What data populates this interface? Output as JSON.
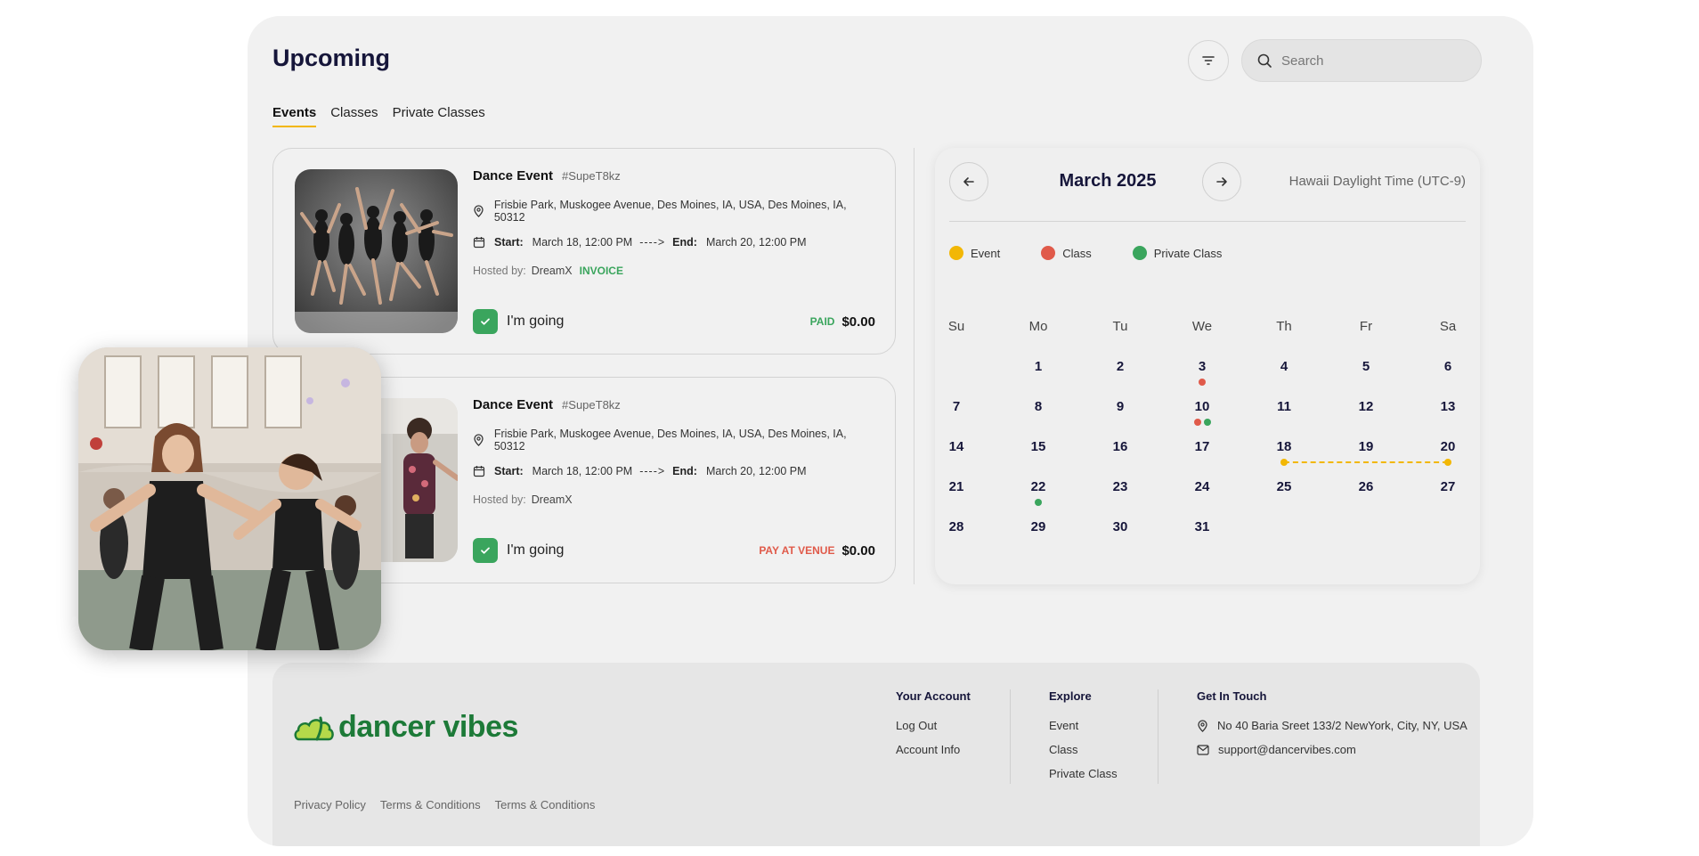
{
  "header": {
    "title": "Upcoming",
    "search_placeholder": "Search"
  },
  "tabs": [
    {
      "label": "Events",
      "active": true
    },
    {
      "label": "Classes",
      "active": false
    },
    {
      "label": "Private Classes",
      "active": false
    }
  ],
  "events": [
    {
      "title": "Dance Event",
      "code": "#SupeT8kz",
      "location": "Frisbie Park, Muskogee Avenue, Des Moines, IA, USA, Des Moines, IA, 50312",
      "start_label": "Start:",
      "start": "March 18, 12:00 PM",
      "arrow": "---->",
      "end_label": "End:",
      "end": "March 20, 12:00 PM",
      "hosted_label": "Hosted by:",
      "host": "DreamX",
      "invoice": "INVOICE",
      "going": "I'm going",
      "status": "PAID",
      "price": "$0.00"
    },
    {
      "title": "Dance Event",
      "code": "#SupeT8kz",
      "location": "Frisbie Park, Muskogee Avenue, Des Moines, IA, USA, Des Moines, IA, 50312",
      "start_label": "Start:",
      "start": "March 18, 12:00 PM",
      "arrow": "---->",
      "end_label": "End:",
      "end": "March 20, 12:00 PM",
      "hosted_label": "Hosted by:",
      "host": "DreamX",
      "going": "I'm going",
      "status": "PAY AT VENUE",
      "price": "$0.00"
    }
  ],
  "calendar": {
    "month": "March 2025",
    "timezone": "Hawaii Daylight Time (UTC-9)",
    "legend": [
      {
        "label": "Event",
        "color": "#f2b705"
      },
      {
        "label": "Class",
        "color": "#e05a4a"
      },
      {
        "label": "Private Class",
        "color": "#3aa55d"
      }
    ],
    "weekdays": [
      "Su",
      "Mo",
      "Tu",
      "We",
      "Th",
      "Fr",
      "Sa"
    ],
    "days_in_month": 31,
    "first_weekday": 1,
    "markers": [
      {
        "day": 3,
        "types": [
          "class"
        ]
      },
      {
        "day": 10,
        "types": [
          "class",
          "private"
        ]
      },
      {
        "day": 18,
        "types": [
          "event"
        ]
      },
      {
        "day": 20,
        "types": [
          "event"
        ]
      },
      {
        "day": 22,
        "types": [
          "private"
        ]
      }
    ],
    "event_range": [
      18,
      20
    ]
  },
  "footer": {
    "logo_text": "ancer vibes",
    "logo_initial": "d",
    "your_account": {
      "heading": "Your Account",
      "links": [
        "Log Out",
        "Account Info"
      ]
    },
    "explore": {
      "heading": "Explore",
      "links": [
        "Event",
        "Class",
        "Private Class"
      ]
    },
    "contact": {
      "heading": "Get In Touch",
      "address": "No 40 Baria Sreet 133/2 NewYork, City, NY, USA",
      "email": "support@dancervibes.com"
    },
    "legal": [
      "Privacy Policy",
      "Terms & Conditions",
      "Terms & Conditions"
    ]
  },
  "colors": {
    "accent": "#f2b705",
    "brand_green": "#1d7a38",
    "success": "#3aa55d",
    "danger": "#e05a4a"
  }
}
